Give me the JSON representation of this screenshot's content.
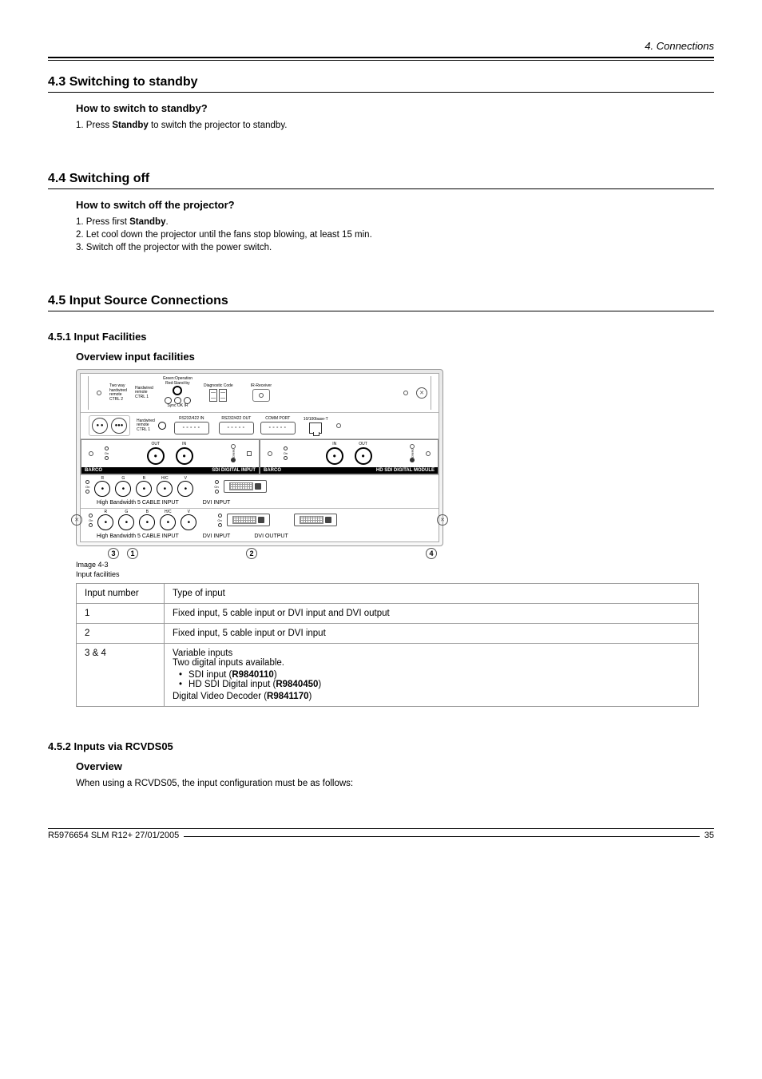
{
  "header": {
    "chapter": "4.  Connections"
  },
  "s43": {
    "title": "4.3  Switching to standby",
    "sub": "How to switch to standby?",
    "step1_pre": "1.  Press ",
    "step1_b": "Standby",
    "step1_post": " to switch the projector to standby."
  },
  "s44": {
    "title": "4.4  Switching off",
    "sub": "How to switch off the projector?",
    "step1_pre": "1.  Press first ",
    "step1_b": "Standby",
    "step1_post": ".",
    "step2": "2.  Let cool down the projector until the fans stop blowing, at least 15 min.",
    "step3": "3.  Switch off the projector with the power switch."
  },
  "s45": {
    "title": "4.5  Input Source Connections",
    "s451": {
      "title": "4.5.1   Input Facilities",
      "sub": "Overview input facilities",
      "fig_labels": {
        "two_way": "Two way\nhardwired\nremote\nCTRL 2",
        "hardwired": "Hardwired\nremote\nCTRL 1",
        "hardwired2": "Hardwired\nremote\nCTRL 1",
        "green": "Green:Operation",
        "red": "Red:Stand-by",
        "diag": "Diagnostic Code",
        "ir": "IR-Receiver",
        "sync_ir": "Sync OK   IR",
        "rs_in": "RS232/422 IN",
        "rs_out": "RS232/422 OUT",
        "comm": "COMM PORT",
        "net": "10/100base-T",
        "out": "OUT",
        "in": "IN",
        "on": "On",
        "select": "Select",
        "barco": "BARCO",
        "sdi_strip": "SDI DIGITAL INPUT",
        "hd_strip": "HD SDI DIGITAL MODULE",
        "r": "R",
        "g": "G",
        "b": "B",
        "hc": "H/C",
        "v": "V",
        "hb5": "High Bandwidth  5 CABLE INPUT",
        "dvi_in": "DVI INPUT",
        "dvi_out": "DVI OUTPUT"
      },
      "callouts": {
        "c1": "1",
        "c2": "2",
        "c3": "3",
        "c4": "4"
      },
      "caption_line1": "Image 4-3",
      "caption_line2": "Input facilities",
      "table": {
        "h1": "Input number",
        "h2": "Type of input",
        "r1_num": "1",
        "r1_txt": "Fixed input, 5 cable input or DVI input and DVI output",
        "r2_num": "2",
        "r2_txt": "Fixed input, 5 cable input or DVI input",
        "r3_num": "3 & 4",
        "r3_l1": "Variable inputs",
        "r3_l2": "Two digital inputs available.",
        "r3_b1_pre": "SDI input (",
        "r3_b1_b": "R9840110",
        "r3_b1_post": ")",
        "r3_b2_pre": "HD SDI Digital input (",
        "r3_b2_b": "R9840450",
        "r3_b2_post": ")",
        "r3_l3_pre": "Digital Video Decoder (",
        "r3_l3_b": "R9841170",
        "r3_l3_post": ")"
      }
    },
    "s452": {
      "title": "4.5.2   Inputs via RCVDS05",
      "sub": "Overview",
      "body": "When using a RCVDS05, the input configuration must be as follows:"
    }
  },
  "footer": {
    "doc": "R5976654  SLM R12+  27/01/2005",
    "page": "35"
  }
}
